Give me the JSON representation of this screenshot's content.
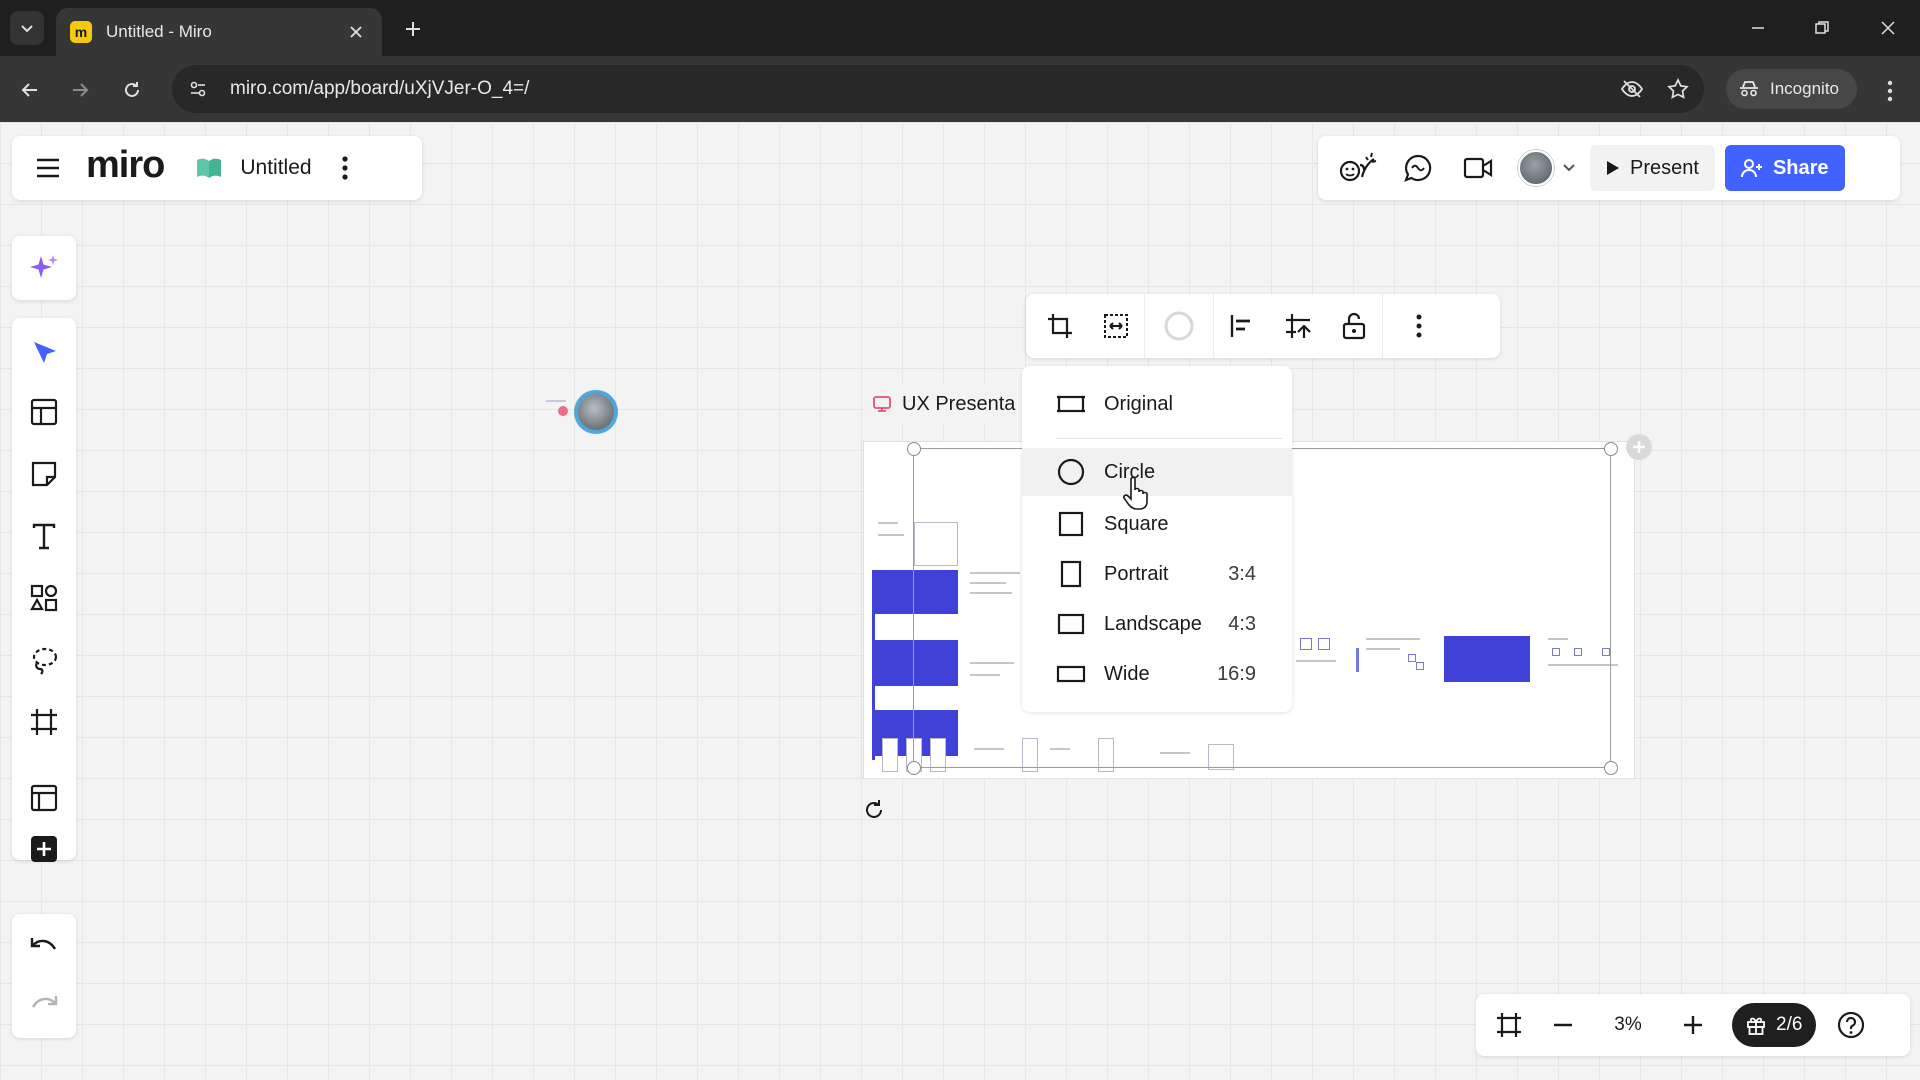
{
  "browser": {
    "tab_title": "Untitled - Miro",
    "url": "miro.com/app/board/uXjVJer-O_4=/",
    "incognito_label": "Incognito"
  },
  "header": {
    "logo": "miro",
    "board_title": "Untitled",
    "present_label": "Present",
    "share_label": "Share"
  },
  "frame": {
    "label": "UX Presenta"
  },
  "crop_menu": {
    "items": [
      {
        "label": "Original",
        "ratio": ""
      },
      {
        "label": "Circle",
        "ratio": ""
      },
      {
        "label": "Square",
        "ratio": ""
      },
      {
        "label": "Portrait",
        "ratio": "3:4"
      },
      {
        "label": "Landscape",
        "ratio": "4:3"
      },
      {
        "label": "Wide",
        "ratio": "16:9"
      }
    ],
    "hovered": "Circle"
  },
  "bottom_bar": {
    "zoom": "3%",
    "pages": "2/6"
  },
  "colors": {
    "accent": "#4262ff",
    "frame_block": "#4041d6",
    "ai_sparkle": "#8b5cf6"
  }
}
